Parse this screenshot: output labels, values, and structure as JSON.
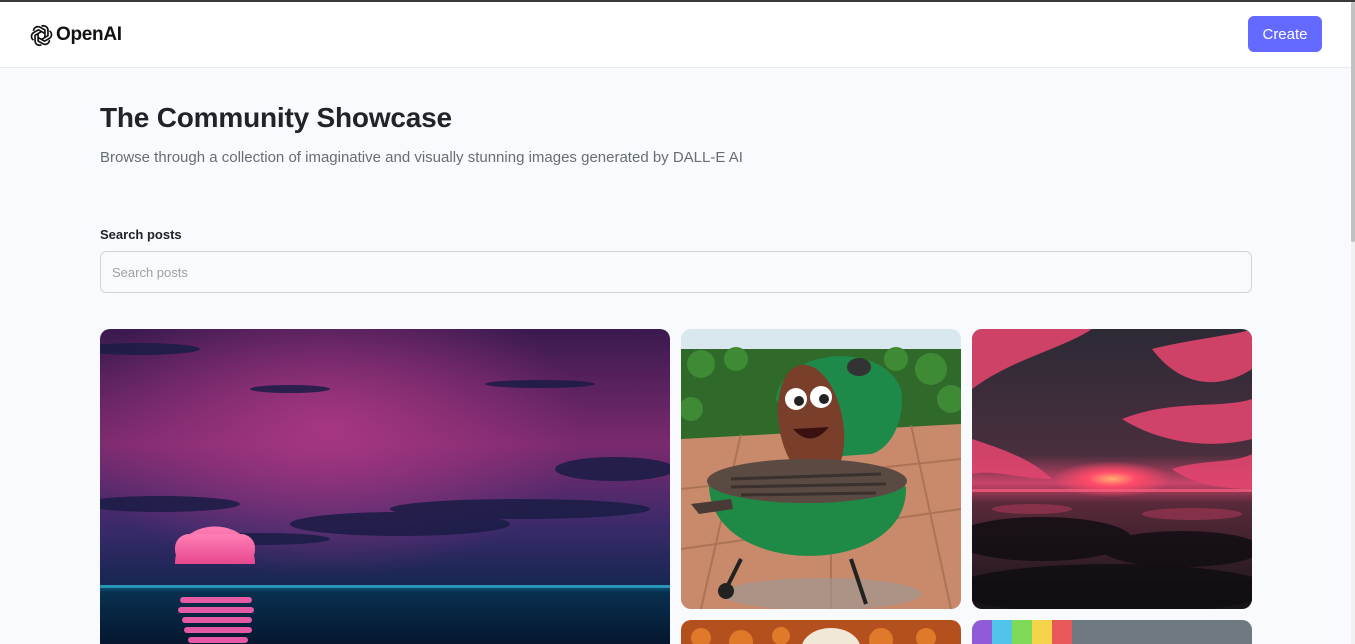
{
  "header": {
    "logo_text": "OpenAI",
    "create_label": "Create"
  },
  "main": {
    "title": "The Community Showcase",
    "subtitle": "Browse through a collection of imaginative and visually stunning images generated by DALL-E AI"
  },
  "search": {
    "label": "Search posts",
    "placeholder": "Search posts",
    "value": ""
  },
  "colors": {
    "accent": "#6469ff",
    "page_bg": "#f9fafe",
    "title": "#222328",
    "subtitle": "#666e75"
  },
  "icons": {
    "logo": "openai-logo-icon"
  }
}
